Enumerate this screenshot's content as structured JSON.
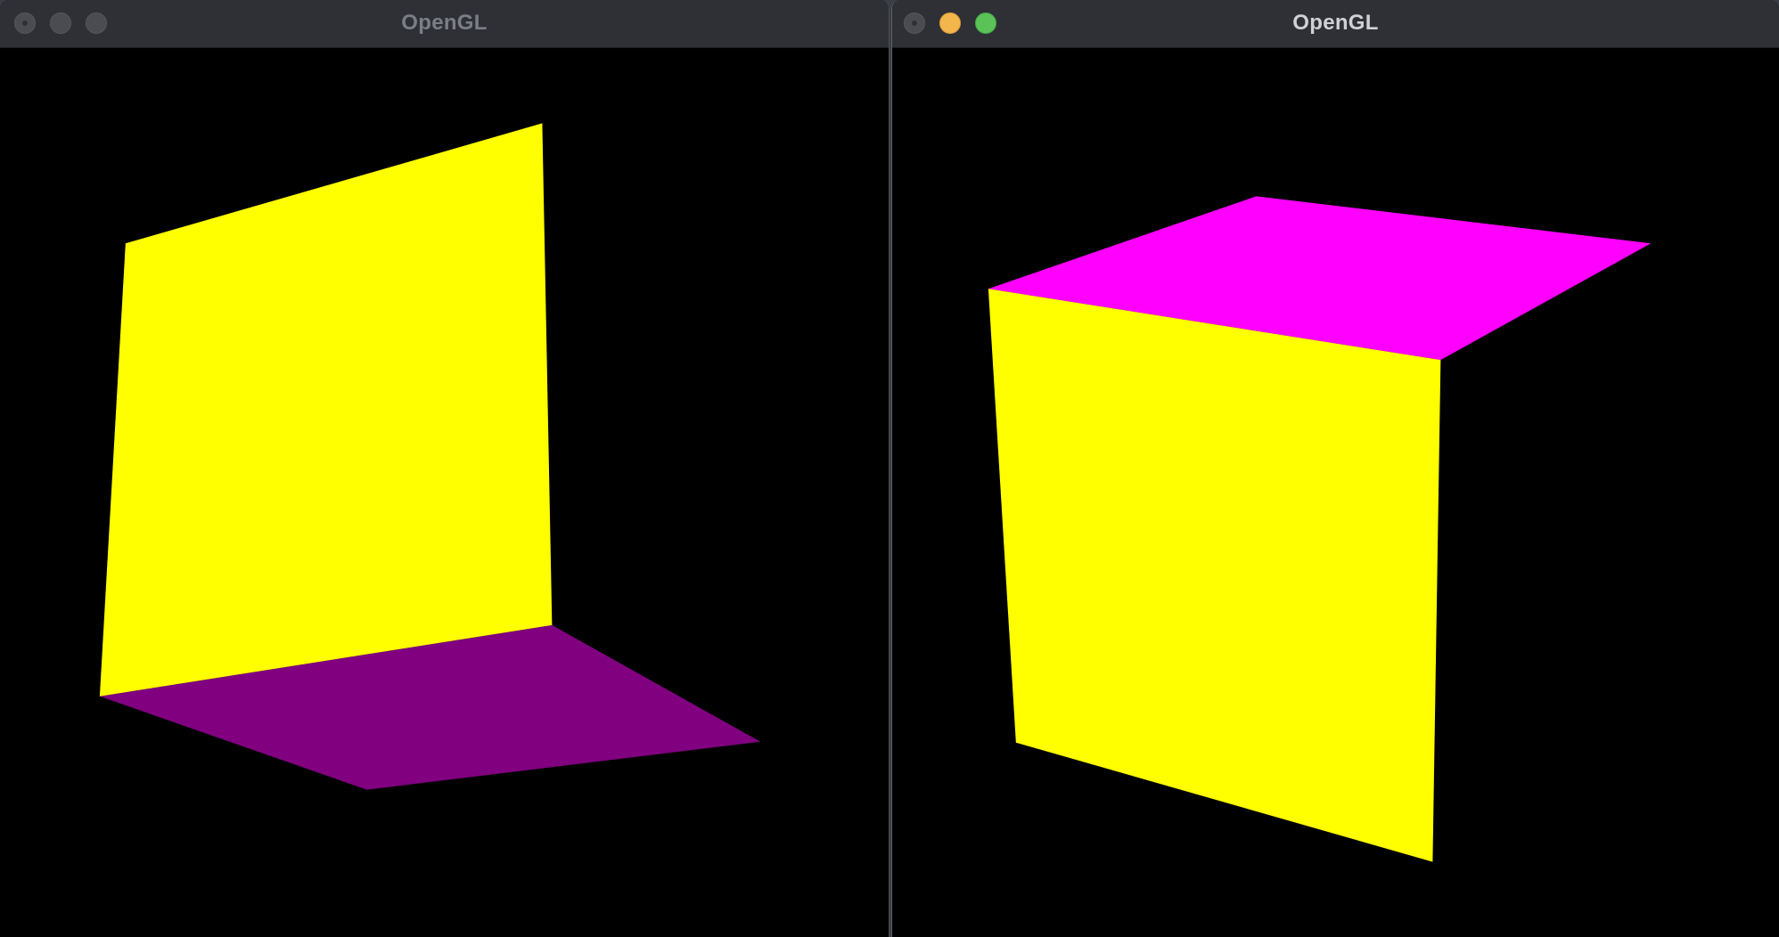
{
  "windows": [
    {
      "title": "OpenGL",
      "active": false,
      "faces": [
        {
          "name": "front-face",
          "color": "#ffff00"
        },
        {
          "name": "bottom-face",
          "color": "#800080"
        }
      ]
    },
    {
      "title": "OpenGL",
      "active": true,
      "traffic_colors": {
        "minimize": "#f3b64c",
        "zoom": "#5ac256"
      },
      "faces": [
        {
          "name": "top-face",
          "color": "#ff00ff"
        },
        {
          "name": "front-face",
          "color": "#ffff00"
        }
      ]
    }
  ]
}
